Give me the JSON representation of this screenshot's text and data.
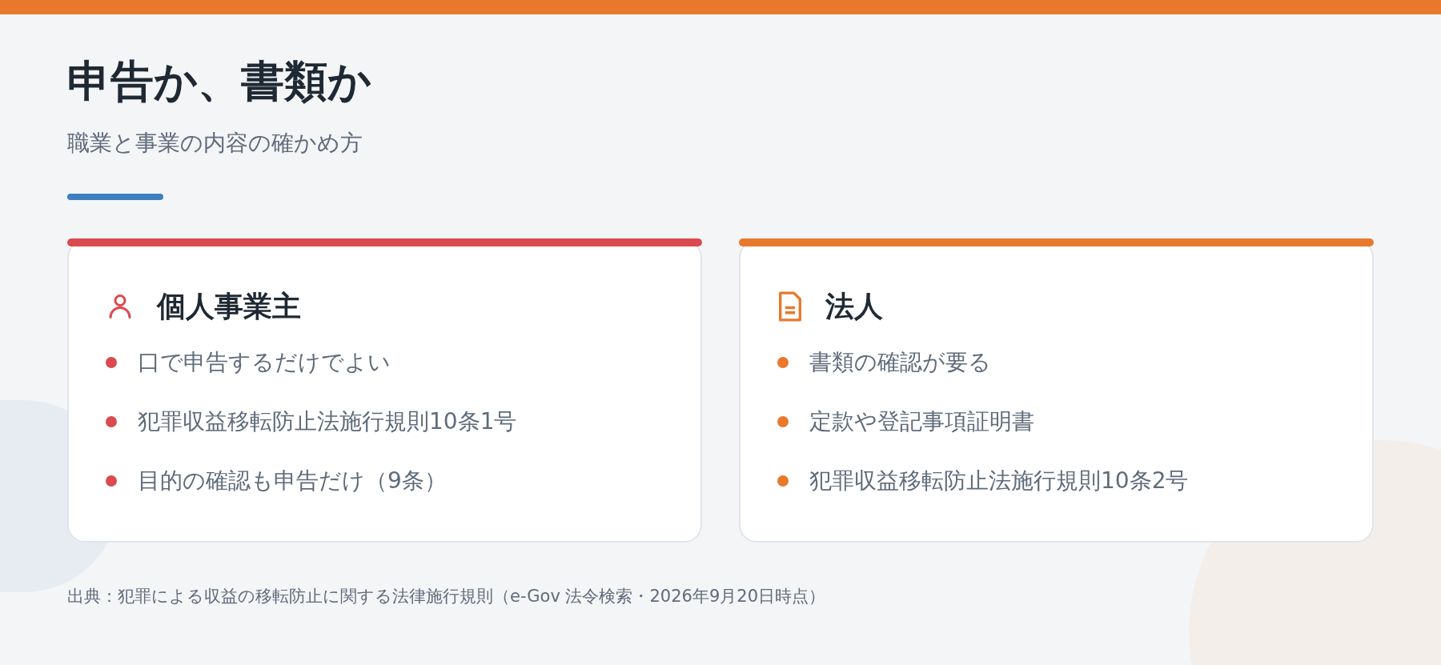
{
  "title": "申告か、書類か",
  "subtitle": "職業と事業の内容の確かめ方",
  "cards": [
    {
      "kind": "person",
      "color": "#db4a4f",
      "heading": "個人事業主",
      "items": [
        "口で申告するだけでよい",
        "犯罪収益移転防止法施行規則10条1号",
        "目的の確認も申告だけ（9条）"
      ]
    },
    {
      "kind": "document",
      "color": "#e8792c",
      "heading": "法人",
      "items": [
        "書類の確認が要る",
        "定款や登記事項証明書",
        "犯罪収益移転防止法施行規則10条2号"
      ]
    }
  ],
  "footer": "出典：犯罪による収益の移転防止に関する法律施行規則（e-Gov 法令検索・2026年9月20日時点）"
}
